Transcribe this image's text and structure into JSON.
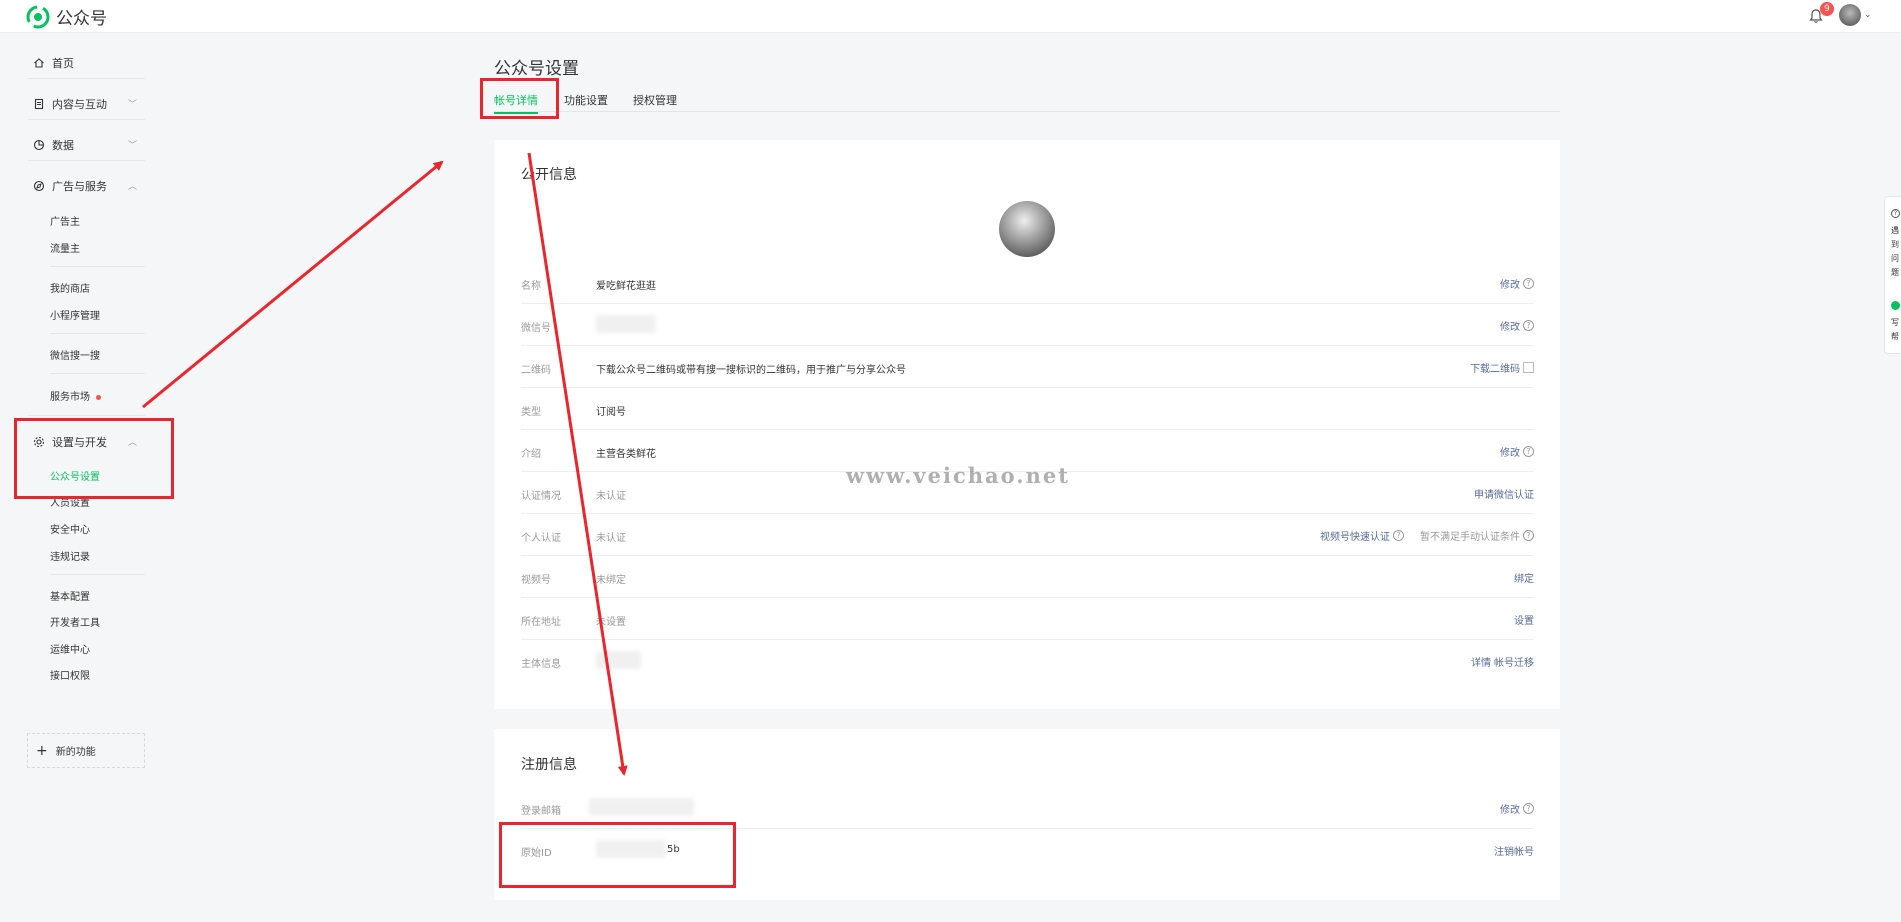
{
  "app": {
    "name": "公众号"
  },
  "header": {
    "notification_count": "9"
  },
  "sidebar": {
    "home": "首页",
    "content": "内容与互动",
    "data": "数据",
    "ads": "广告与服务",
    "ads_sub": [
      "广告主",
      "流量主"
    ],
    "store_sub": [
      "我的商店",
      "小程序管理"
    ],
    "wechat_sub": [
      "微信搜一搜"
    ],
    "market": "服务市场",
    "settings": "设置与开发",
    "settings_sub": [
      "公众号设置",
      "人员设置",
      "安全中心",
      "违规记录"
    ],
    "dev_sub": [
      "基本配置",
      "开发者工具",
      "运维中心",
      "接口权限"
    ],
    "new_function": "新的功能"
  },
  "page": {
    "title": "公众号设置",
    "tabs": [
      "帐号详情",
      "功能设置",
      "授权管理"
    ]
  },
  "public_info": {
    "title": "公开信息",
    "rows": [
      {
        "label": "名称",
        "value": "爱吃鲜花逛逛",
        "action": "修改"
      },
      {
        "label": "微信号",
        "value": "",
        "action": "修改"
      },
      {
        "label": "二维码",
        "value": "下载公众号二维码或带有搜一搜标识的二维码，用于推广与分享公众号",
        "action": "下载二维码"
      },
      {
        "label": "类型",
        "value": "订阅号",
        "action": ""
      },
      {
        "label": "介绍",
        "value": "主营各类鲜花",
        "action": "修改"
      },
      {
        "label": "认证情况",
        "value": "未认证",
        "action": "申请微信认证"
      },
      {
        "label": "个人认证",
        "value": "未认证",
        "action": "视频号快速认证",
        "action2": "暂不满足手动认证条件"
      },
      {
        "label": "视频号",
        "value": "未绑定",
        "action": "绑定"
      },
      {
        "label": "所在地址",
        "value": "未设置",
        "action": "设置"
      },
      {
        "label": "主体信息",
        "value": "",
        "action": "详情",
        "action2": "帐号迁移"
      }
    ]
  },
  "register_info": {
    "title": "注册信息",
    "rows": [
      {
        "label": "登录邮箱",
        "value": "",
        "action": "修改"
      },
      {
        "label": "原始ID",
        "value": "5b",
        "action": "注销帐号"
      }
    ]
  },
  "watermark": "www.veichao.net",
  "side_widget": [
    "遇",
    "到",
    "问",
    "题",
    "写",
    "帮"
  ],
  "colors": {
    "accent": "#07c160",
    "link": "#576b95",
    "annotation": "#e8262e"
  }
}
